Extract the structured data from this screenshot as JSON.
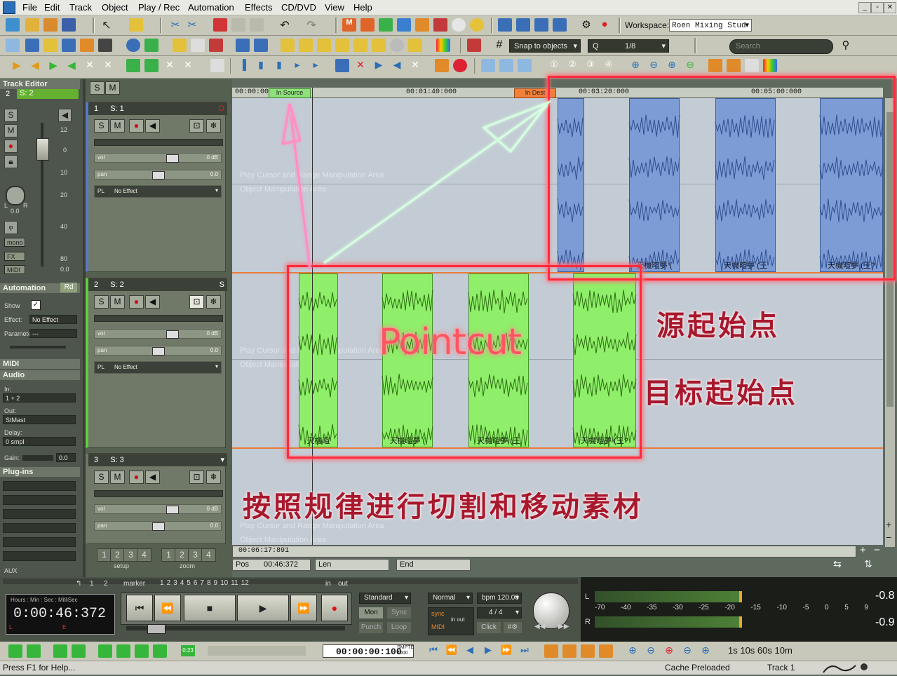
{
  "menu": [
    "File",
    "Edit",
    "Track",
    "Object",
    "Play / Rec",
    "Automation",
    "Effects",
    "CD/DVD",
    "View",
    "Help"
  ],
  "toolbar": {
    "workspace_label": "Workspace:",
    "workspace_value": "Roen Mixing Stud",
    "snap_label": "Snap to objects",
    "quantize_label": "Q",
    "quantize_value": "1/8",
    "search_placeholder": "Search"
  },
  "left": {
    "track_editor": "Track Editor",
    "track_num": "2",
    "track_name": "S: 2",
    "pan_value": "0.0",
    "fader_scale": [
      "12",
      "0",
      "10",
      "20",
      "40",
      "80",
      "0.0"
    ],
    "labels_lr": [
      "L",
      "R"
    ],
    "btn_mono": "mono",
    "btn_fx": "FX",
    "btn_midi": "MIDI",
    "automation": "Automation",
    "automation_mode": "Rd",
    "show_label": "Show",
    "effect_label": "Effect:",
    "effect_value": "No Effect",
    "parameter_label": "Parameter:",
    "parameter_value": "---",
    "midi": "MIDI",
    "audio": "Audio",
    "in_label": "In:",
    "in_value": "1 + 2",
    "out_label": "Out:",
    "out_value": "StMast",
    "delay_label": "Delay:",
    "delay_value": "0 smpl",
    "gain_label": "Gain:",
    "gain_value": "0.0",
    "plugins": "Plug-ins",
    "aux": "AUX"
  },
  "tracks": [
    {
      "num": "1",
      "name": "S: 1",
      "vol": "0 dB",
      "pan": "0.0",
      "fx": "No Effect"
    },
    {
      "num": "2",
      "name": "S: 2",
      "vol": "0 dB",
      "pan": "0.0",
      "fx": "No Effect"
    },
    {
      "num": "3",
      "name": "S: 3",
      "vol": "0 dB",
      "pan": "0.0",
      "fx": ""
    }
  ],
  "track_letters": {
    "s": "S",
    "m": "M",
    "pl": "PL",
    "vol": "vol",
    "pan": "pan"
  },
  "ruler": {
    "ticks": [
      "00:00:00:000",
      "00:01:40:000",
      "00:03:20:000",
      "00:05:00:000"
    ],
    "in_source": "In Source",
    "in_dest": "In Dest"
  },
  "lanes": {
    "hint_play": "Play Cursor and Range Manipulation Area",
    "hint_object": "Object Manipulation Area"
  },
  "clips": {
    "track1": [
      "",
      "天機暄夢 (",
      "天機暄夢 (王",
      "天機暄夢 (王?"
    ],
    "track2": [
      "天機暄",
      "天機暄夢 (",
      "天機暄夢 (王",
      "天機暄夢 (王?"
    ]
  },
  "annotations": {
    "pointcut": "Pointcut",
    "source_start": "源起始点",
    "dest_start": "目标起始点",
    "instruction": "按照规律进行切割和移动素材"
  },
  "scroll": {
    "position": "00:06:17:891",
    "pos_label": "Pos",
    "pos_value": "00:46:372",
    "len_label": "Len",
    "end_label": "End"
  },
  "setup": {
    "label": "setup",
    "zoom": "zoom",
    "numbers": [
      "1",
      "2",
      "3",
      "4"
    ]
  },
  "transport": {
    "marker_label": "marker",
    "marker_numbers": [
      "1",
      "2",
      "3",
      "4",
      "5",
      "6",
      "7",
      "8",
      "9",
      "10",
      "11",
      "12"
    ],
    "in": "in",
    "out": "out",
    "time_format": "Hours : Min : Sec : MilliSec",
    "time": "0:00:46:372",
    "mode": "Standard",
    "mon": "Mon",
    "sync": "Sync",
    "punch": "Punch",
    "loop": "Loop",
    "normal": "Normal",
    "bpm": "bpm 120.00",
    "sig": "4 / 4",
    "click": "Click",
    "sync_badge": "sync",
    "midi_badge": "MIDI",
    "in_out": "in out",
    "small_l": "L",
    "small_e": "E"
  },
  "meters": {
    "scale": [
      "-70",
      "-40",
      "-35",
      "-30",
      "-25",
      "-20",
      "-15",
      "-10",
      "-5",
      "0",
      "5",
      "9"
    ],
    "left_peak": "-0.8",
    "right_peak": "-0.9",
    "L": "L",
    "R": "R"
  },
  "bottom": {
    "counter": "00:00:00:100",
    "smpte": "SMPTE 1000",
    "zoom_presets": "1s 10s 60s 10m",
    "badge": "0:23"
  },
  "status": {
    "help": "Press F1 for Help...",
    "cache": "Cache Preloaded",
    "track": "Track 1"
  },
  "colors": {
    "blue_clip": "#7d9cd6",
    "green_clip": "#8fef6a",
    "highlight_red": "#ff2a3c",
    "annotation_red": "#a8182c"
  }
}
